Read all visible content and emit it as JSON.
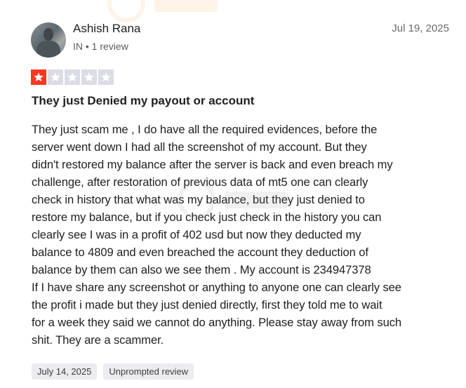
{
  "reviewer": {
    "name": "Ashish Rana",
    "meta": "IN • 1 review",
    "avatar_icon": "user-avatar"
  },
  "review": {
    "date": "Jul 19, 2025",
    "rating": 1,
    "max_rating": 5,
    "star_color": "#ff3722",
    "title": "They just Denied my payout or account",
    "body": "They just scam me , I do have all the required evidences, before the\nserver went down I had all the screenshot of my account. But they\ndidn't restored my balance after the server is back and even breach my\nchallenge, after restoration of previous data of mt5 one can clearly\ncheck in history that what was my balance, but they just denied to\nrestore my balance, but if you check just check in the history you can\nclearly see I was in a profit of 402 usd but now they deducted my\nbalance to 4809 and even breached the account they deduction of\nbalance by them can also we see them . My account is 234947378\nIf I have share any screenshot or anything to anyone one can clearly see\nthe profit i made but they just denied directly, first they told me to wait\nfor a week they said we cannot do anything. Please stay away from such\nshit. They are a scammer.",
    "tags": [
      "July 14, 2025",
      "Unprompted review"
    ]
  }
}
